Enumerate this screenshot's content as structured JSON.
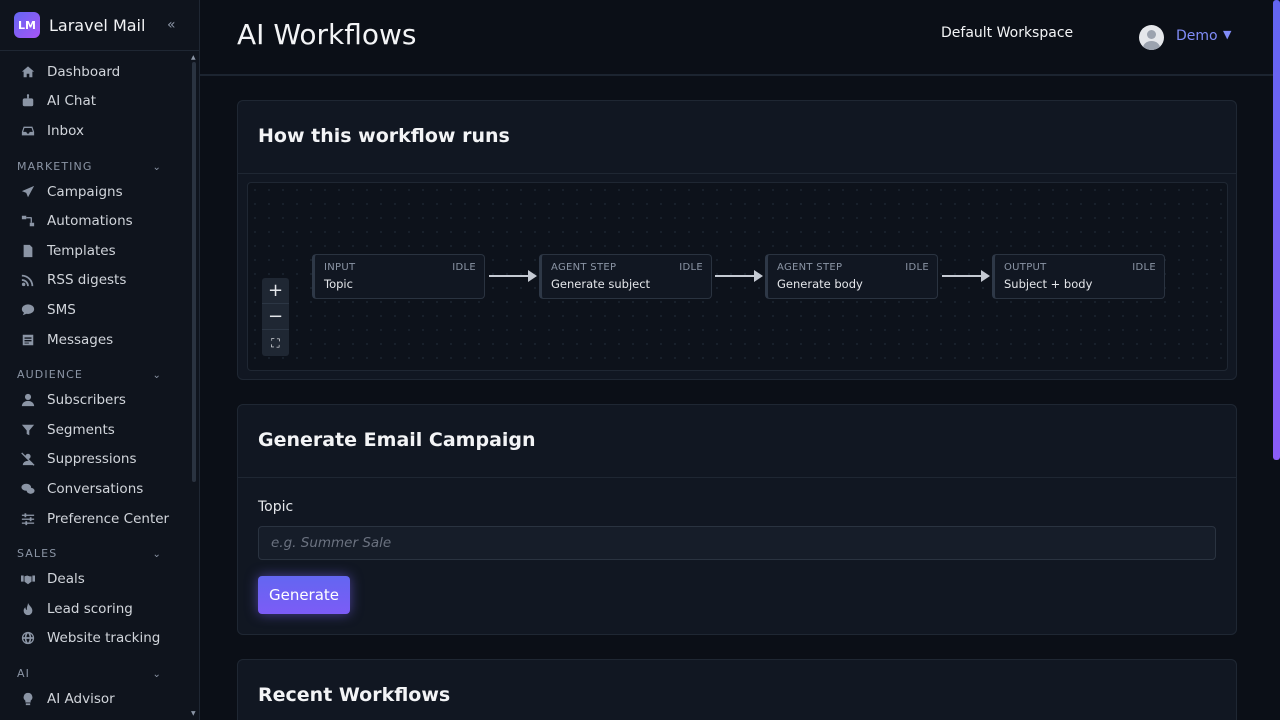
{
  "brand": {
    "logo": "LM",
    "name": "Laravel Mail",
    "collapse_icon": "«"
  },
  "sidebar": {
    "top_items": [
      {
        "label": "Dashboard",
        "icon": "home-icon"
      },
      {
        "label": "AI Chat",
        "icon": "robot-icon"
      },
      {
        "label": "Inbox",
        "icon": "inbox-icon"
      }
    ],
    "sections": [
      {
        "title": "MARKETING",
        "items": [
          {
            "label": "Campaigns",
            "icon": "paper-plane-icon"
          },
          {
            "label": "Automations",
            "icon": "flow-icon"
          },
          {
            "label": "Templates",
            "icon": "file-icon"
          },
          {
            "label": "RSS digests",
            "icon": "rss-icon"
          },
          {
            "label": "SMS",
            "icon": "sms-icon"
          },
          {
            "label": "Messages",
            "icon": "messages-icon"
          }
        ]
      },
      {
        "title": "AUDIENCE",
        "items": [
          {
            "label": "Subscribers",
            "icon": "user-icon"
          },
          {
            "label": "Segments",
            "icon": "filter-icon"
          },
          {
            "label": "Suppressions",
            "icon": "user-slash-icon"
          },
          {
            "label": "Conversations",
            "icon": "comments-icon"
          },
          {
            "label": "Preference Center",
            "icon": "sliders-icon"
          }
        ]
      },
      {
        "title": "SALES",
        "items": [
          {
            "label": "Deals",
            "icon": "handshake-icon"
          },
          {
            "label": "Lead scoring",
            "icon": "fire-icon"
          },
          {
            "label": "Website tracking",
            "icon": "globe-icon"
          }
        ]
      },
      {
        "title": "AI",
        "items": [
          {
            "label": "AI Advisor",
            "icon": "lightbulb-icon"
          }
        ]
      }
    ]
  },
  "header": {
    "title": "AI Workflows",
    "workspace": "Default Workspace",
    "user": "Demo"
  },
  "workflow_card": {
    "title": "How this workflow runs",
    "zoom": {
      "in": "+",
      "out": "−",
      "fit": "⛶"
    },
    "nodes": [
      {
        "type": "INPUT",
        "status": "IDLE",
        "label": "Topic"
      },
      {
        "type": "AGENT STEP",
        "status": "IDLE",
        "label": "Generate subject"
      },
      {
        "type": "AGENT STEP",
        "status": "IDLE",
        "label": "Generate body"
      },
      {
        "type": "OUTPUT",
        "status": "IDLE",
        "label": "Subject + body"
      }
    ]
  },
  "generate_card": {
    "title": "Generate Email Campaign",
    "field_label": "Topic",
    "placeholder": "e.g. Summer Sale",
    "value": "",
    "button": "Generate"
  },
  "recent_card": {
    "title": "Recent Workflows"
  },
  "colors": {
    "accent": "#6366f1",
    "accent_2": "#8b5cf6",
    "link": "#818cf8",
    "background": "#0b0f17"
  }
}
